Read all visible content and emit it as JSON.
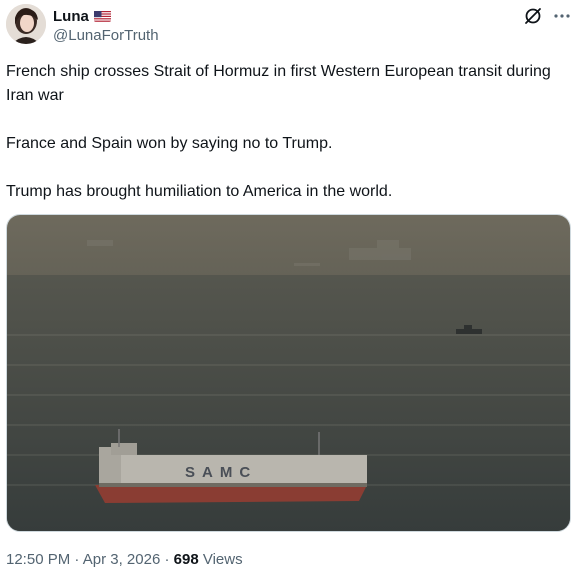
{
  "author": {
    "display_name": "Luna",
    "handle": "@LunaForTruth",
    "flag_icon": "us-flag-icon"
  },
  "actions": {
    "grok_icon": "grok-icon",
    "more_icon": "more-options-icon"
  },
  "tweet": {
    "paragraphs": [
      "French ship crosses Strait of Hormuz in first Western European transit during Iran war",
      "France and Spain won by saying no to Trump.",
      "Trump has brought humiliation to America in the world."
    ]
  },
  "media": {
    "ship_label": "SAMC"
  },
  "meta": {
    "time": "12:50 PM",
    "sep1": " · ",
    "date": "Apr 3, 2026",
    "sep2": " · ",
    "views_count": "698",
    "views_label": " Views"
  },
  "colors": {
    "text": "#0f1419",
    "secondary": "#536471",
    "border": "#cfd9de"
  }
}
